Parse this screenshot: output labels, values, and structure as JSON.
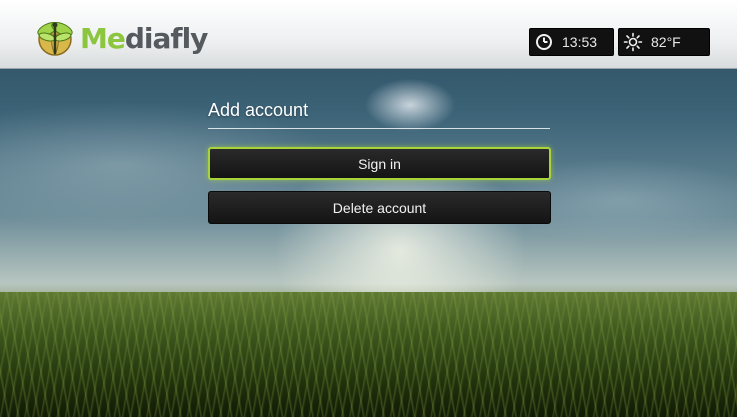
{
  "app": {
    "logo_text_accent": "Me",
    "logo_text_rest": "diafly",
    "logo_icon": "dragonfly-globe-icon"
  },
  "status": {
    "time": "13:53",
    "clock_icon": "clock-icon",
    "temperature": "82°F",
    "weather_icon": "sun-icon"
  },
  "menu": {
    "title": "Add account",
    "items": [
      {
        "label": "Sign in",
        "selected": true
      },
      {
        "label": "Delete account",
        "selected": false
      }
    ]
  },
  "colors": {
    "accent": "#a7d33b",
    "button_bg": "#1a1a1a",
    "logo_green": "#8cc63f",
    "logo_gray": "#555a5e"
  }
}
